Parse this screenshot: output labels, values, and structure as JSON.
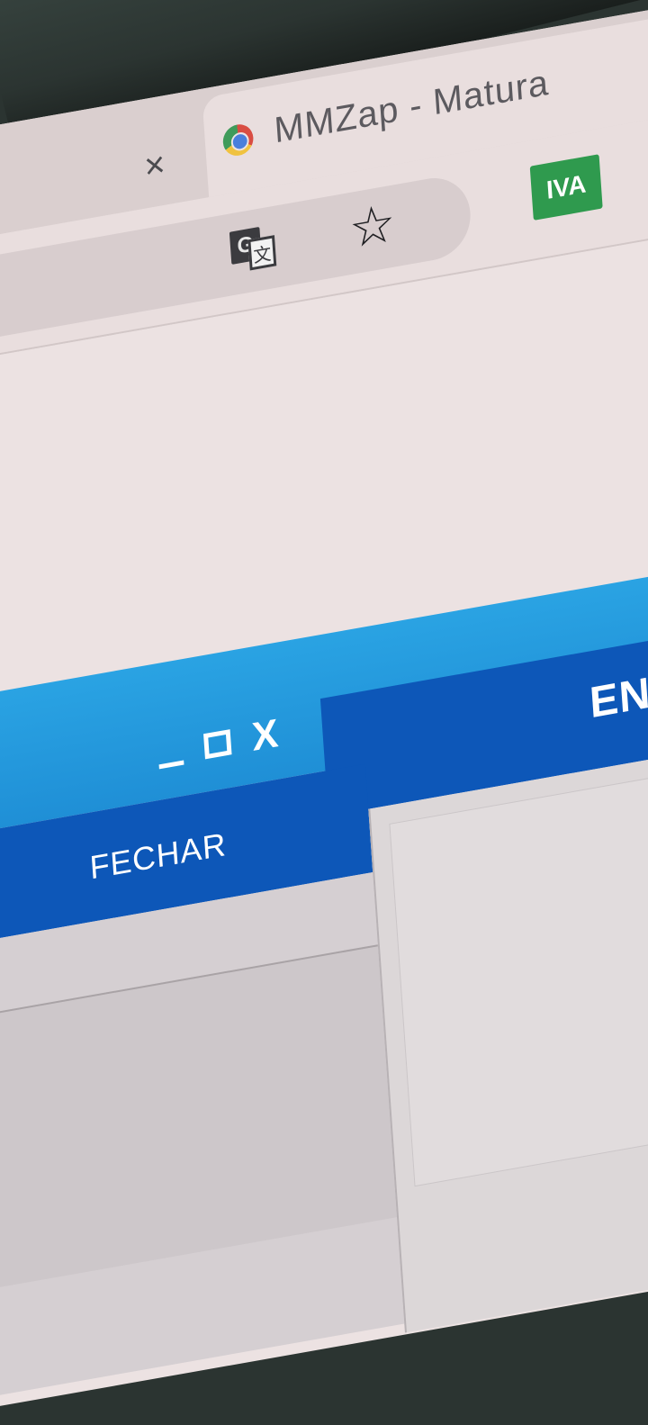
{
  "browser": {
    "prev_tab_close_glyph": "×",
    "active_tab_title": "MMZap - Matura",
    "favicon_icon": "chrome-favicon",
    "translate_icon_letters": [
      "G",
      "文"
    ],
    "bookmark_star_glyph": "☆",
    "extension_label": "IVA"
  },
  "app": {
    "window_controls": {
      "minimize": "minimize-icon",
      "maximize": "maximize-icon",
      "close_glyph": "X"
    },
    "send_button_label": "ENVIA",
    "close_button_label": "FECHAR"
  },
  "colors": {
    "app_header": "#2aa3e3",
    "app_panel": "#0d57b8",
    "extension_bg": "#2f9a4e"
  }
}
